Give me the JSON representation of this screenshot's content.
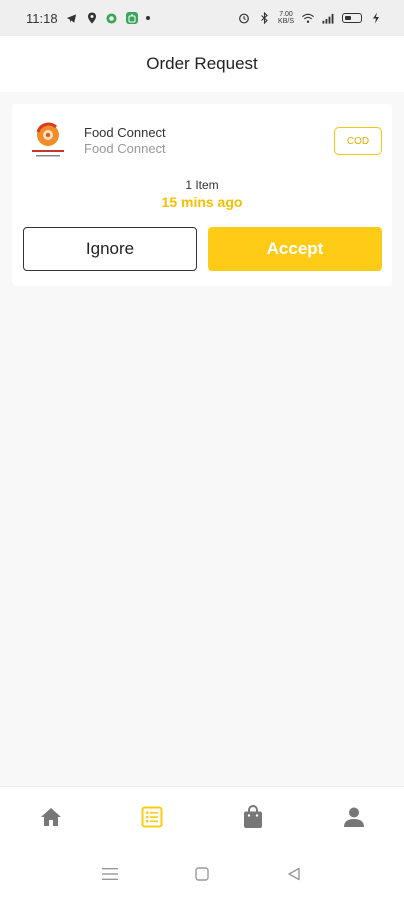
{
  "status_bar": {
    "time": "11:18",
    "speed_top": "7.00",
    "speed_bottom": "KB/S"
  },
  "header": {
    "title": "Order Request"
  },
  "order": {
    "merchant_name": "Food Connect",
    "merchant_subtitle": "Food Connect",
    "payment_badge": "COD",
    "item_count": "1 Item",
    "time_ago": "15 mins ago",
    "ignore_label": "Ignore",
    "accept_label": "Accept"
  },
  "bottom_nav": {
    "items": [
      {
        "icon": "home-icon",
        "active": false
      },
      {
        "icon": "orders-list-icon",
        "active": true
      },
      {
        "icon": "shopping-bag-icon",
        "active": false
      },
      {
        "icon": "profile-icon",
        "active": false
      }
    ]
  },
  "colors": {
    "accent": "#fecb16",
    "accent_text": "#f5c000",
    "nav_inactive": "#777777"
  }
}
